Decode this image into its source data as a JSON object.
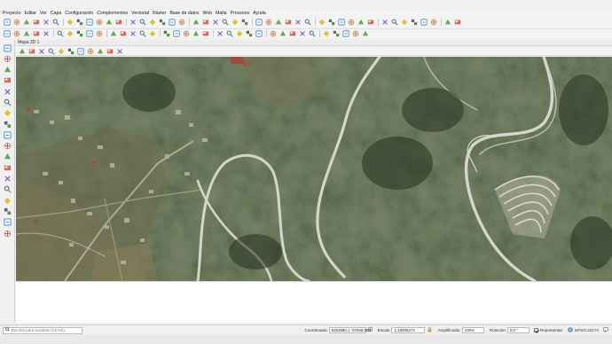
{
  "menu": [
    "Proyecto",
    "Editar",
    "Ver",
    "Capa",
    "Configuración",
    "Complementos",
    "Vectorial",
    "Ráster",
    "Base de datos",
    "Web",
    "Malla",
    "Procesos",
    "Ayuda"
  ],
  "map_panel": {
    "title": "Mapa 3D 1"
  },
  "status": {
    "locator_placeholder": "Escriba para localizar (Ctrl+K)",
    "coord_label": "Coordenada",
    "coord_value": "6262880,1 -97848,008",
    "scale_label": "Escala",
    "scale_value": "1:10006272",
    "magnifier_label": "Amplificador",
    "magnifier_value": "100%",
    "rotation_label": "Rotación",
    "rotation_value": "0,0 °",
    "render_label": "Representar",
    "crs": "EPSG:22174"
  },
  "colors": {
    "forest_dark": "#2f3d26",
    "forest_mid": "#4b5a38",
    "scrub": "#6b6a48",
    "road": "#cfcfc8",
    "bare": "#a89a7a"
  },
  "icons": {
    "toolbar1": [
      "new-project-icon",
      "open-project-icon",
      "save-project-icon",
      "pan-icon",
      "zoom-in-icon",
      "zoom-out-icon",
      "zoom-full-icon",
      "zoom-layer-icon",
      "zoom-selection-icon",
      "zoom-last-icon",
      "zoom-next-icon",
      "new-map-view-icon",
      "refresh-icon",
      "temporal-icon",
      "identify-icon",
      "select-icon",
      "deselect-icon",
      "attribute-table-icon",
      "field-calculator-icon",
      "statistics-icon",
      "measure-icon",
      "annotation-icon",
      "text-annotation-icon",
      "tips-icon",
      "db-manager-icon",
      "python-icon",
      "plugin-icon",
      "georeferencer-icon",
      "osm-icon",
      "binoculars-icon",
      "locate-icon",
      "node-tool-icon",
      "digitize-icon",
      "snap-icon",
      "merge-icon",
      "split-icon",
      "reshape-icon",
      "offset-icon",
      "rotate-icon",
      "text-label-icon",
      "new-layout-icon",
      "layout-manager-icon",
      "style-manager-icon",
      "help-icon"
    ],
    "toolbar2": [
      "edit-icon",
      "save-edits-icon",
      "add-feature-icon",
      "move-feature-icon",
      "delete-icon",
      "cut-icon",
      "copy-icon",
      "paste-icon",
      "undo-icon",
      "redo-icon",
      "label-icon",
      "pin-icon",
      "show-hide-label-icon",
      "move-label-icon",
      "rotate-label-icon",
      "change-label-icon",
      "advanced-digitize-icon",
      "shape-icon",
      "circle-icon",
      "ellipse-icon",
      "rectangle-icon",
      "polygon-icon",
      "grass-icon",
      "raster-calc-icon",
      "align-icon",
      "bookmark-icon",
      "overview-icon",
      "pencil-icon",
      "highlighter-icon",
      "pen-icon",
      "paint-icon",
      "style-icon",
      "globe-icon",
      "zoom-native-icon",
      "refresh-2-icon"
    ],
    "left": [
      "add-vector-icon",
      "add-raster-icon",
      "add-mesh-icon",
      "add-delimited-icon",
      "add-geopackage-icon",
      "add-spatialite-icon",
      "add-postgis-icon",
      "add-mssql-icon",
      "add-oracle-icon",
      "add-virtual-icon",
      "add-wms-icon",
      "add-xyz-icon",
      "add-wcs-icon",
      "add-wfs-icon",
      "add-arcgis-icon",
      "add-vector-tile-icon",
      "add-point-cloud-icon",
      "new-shapefile-icon"
    ]
  }
}
